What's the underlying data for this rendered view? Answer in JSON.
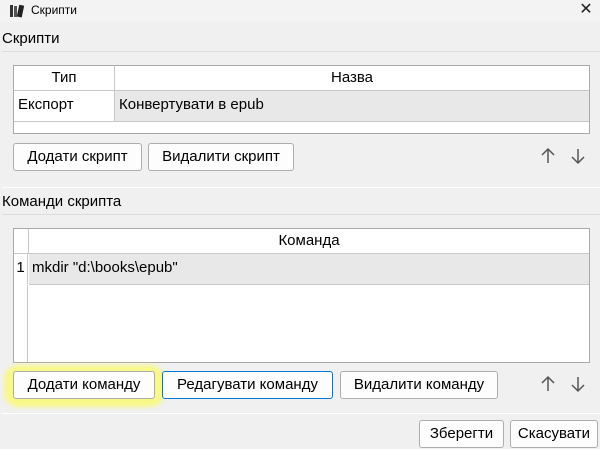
{
  "window": {
    "title": "Скрипти",
    "icon": "app-books-icon",
    "close_glyph": "✕"
  },
  "scripts_section": {
    "title": "Скрипти",
    "columns": [
      "Тип",
      "Назва"
    ],
    "rows": [
      {
        "type": "Експорт",
        "name": "Конвертувати в epub"
      }
    ],
    "add_label": "Додати скрипт",
    "remove_label": "Видалити скрипт"
  },
  "commands_section": {
    "title": "Команди скрипта",
    "columns": [
      "Команда"
    ],
    "rows": [
      {
        "num": "1",
        "command": "mkdir \"d:\\books\\epub\""
      }
    ],
    "add_label": "Додати команду",
    "edit_label": "Редагувати команду",
    "remove_label": "Видалити команду"
  },
  "footer": {
    "save_label": "Зберегти",
    "cancel_label": "Скасувати"
  },
  "colors": {
    "highlight": "#ffff33",
    "focus_border": "#0078d7"
  }
}
